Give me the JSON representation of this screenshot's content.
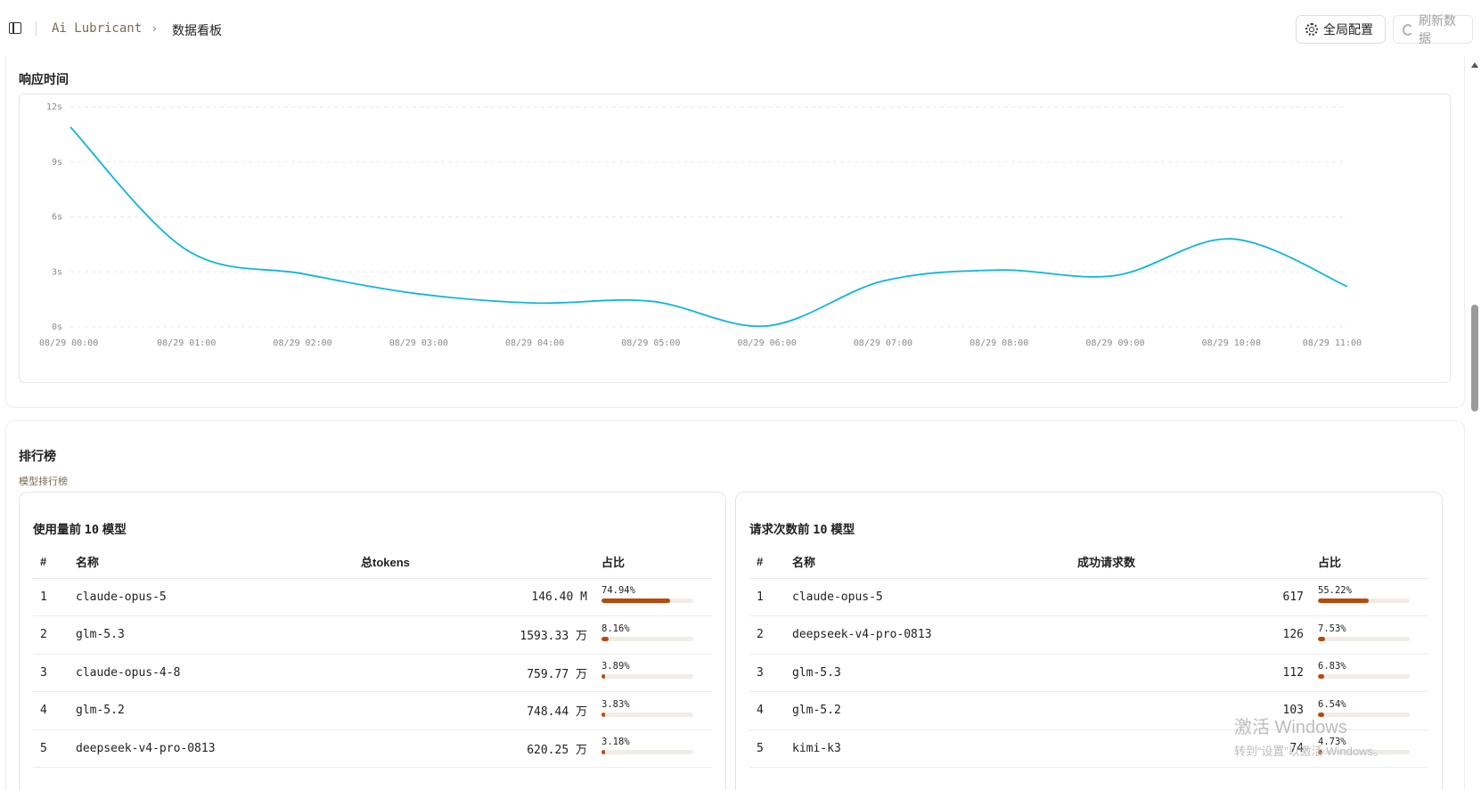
{
  "breadcrumb": {
    "root": "Ai Lubricant",
    "separator": "›",
    "current": "数据看板"
  },
  "header_buttons": {
    "config_label": "全局配置",
    "refresh_label": "刷新数据"
  },
  "response_time": {
    "title": "响应时间",
    "chart_data": {
      "type": "line",
      "title": "响应时间",
      "xlabel": "",
      "ylabel": "",
      "ylim": [
        0,
        12
      ],
      "y_ticks": [
        "0s",
        "3s",
        "6s",
        "9s",
        "12s"
      ],
      "x": [
        "08/29 00:00",
        "08/29 01:00",
        "08/29 02:00",
        "08/29 03:00",
        "08/29 04:00",
        "08/29 05:00",
        "08/29 06:00",
        "08/29 07:00",
        "08/29 08:00",
        "08/29 09:00",
        "08/29 10:00",
        "08/29 11:00"
      ],
      "series": [
        {
          "values": [
            10.9,
            4.2,
            2.9,
            1.8,
            1.3,
            1.4,
            0.05,
            2.5,
            3.1,
            2.8,
            4.8,
            2.2
          ]
        }
      ],
      "grid": true,
      "legend": "none",
      "color": "#12b5d5"
    }
  },
  "ranking": {
    "title": "排行榜",
    "subtitle": "模型排行榜",
    "usage": {
      "title_pre": "使用量前",
      "title_num": "10",
      "title_post": "模型",
      "headers": {
        "idx": "#",
        "name": "名称",
        "value": "总tokens",
        "pct": "占比"
      },
      "rows": [
        {
          "idx": "1",
          "name": "claude-opus-5",
          "value": "146.40 M",
          "pct": "74.94%",
          "frac": 0.7494
        },
        {
          "idx": "2",
          "name": "glm-5.3",
          "value": "1593.33 万",
          "pct": "8.16%",
          "frac": 0.0816
        },
        {
          "idx": "3",
          "name": "claude-opus-4-8",
          "value": "759.77 万",
          "pct": "3.89%",
          "frac": 0.0389
        },
        {
          "idx": "4",
          "name": "glm-5.2",
          "value": "748.44 万",
          "pct": "3.83%",
          "frac": 0.0383
        },
        {
          "idx": "5",
          "name": "deepseek-v4-pro-0813",
          "value": "620.25 万",
          "pct": "3.18%",
          "frac": 0.0318
        }
      ]
    },
    "requests": {
      "title_pre": "请求次数前",
      "title_num": "10",
      "title_post": "模型",
      "headers": {
        "idx": "#",
        "name": "名称",
        "value": "成功请求数",
        "pct": "占比"
      },
      "rows": [
        {
          "idx": "1",
          "name": "claude-opus-5",
          "value": "617",
          "pct": "55.22%",
          "frac": 0.5522
        },
        {
          "idx": "2",
          "name": "deepseek-v4-pro-0813",
          "value": "126",
          "pct": "7.53%",
          "frac": 0.0753
        },
        {
          "idx": "3",
          "name": "glm-5.3",
          "value": "112",
          "pct": "6.83%",
          "frac": 0.0683
        },
        {
          "idx": "4",
          "name": "glm-5.2",
          "value": "103",
          "pct": "6.54%",
          "frac": 0.0654
        },
        {
          "idx": "5",
          "name": "kimi-k3",
          "value": "74",
          "pct": "4.73%",
          "frac": 0.0473
        }
      ]
    }
  },
  "watermark": {
    "line1": "激活 Windows",
    "line2": "转到“设置”以激活 Windows。"
  }
}
